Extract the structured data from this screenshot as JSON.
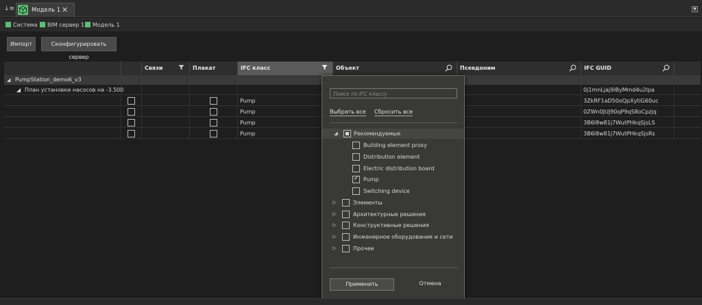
{
  "tab": {
    "title": "Модель 1",
    "close": "✕"
  },
  "breadcrumb": [
    "Система",
    "BIM сервер 1",
    "Модель 1"
  ],
  "toolbar": {
    "import_label": "Импорт",
    "configure_label": "Сконфигурировать сервер"
  },
  "columns": [
    {
      "key": "name",
      "label": ""
    },
    {
      "key": "check",
      "label": ""
    },
    {
      "key": "links",
      "label": "Связи"
    },
    {
      "key": "poster",
      "label": "Плакат"
    },
    {
      "key": "ifc_class",
      "label": "IFC класс"
    },
    {
      "key": "object",
      "label": "Объект"
    },
    {
      "key": "alias",
      "label": "Псевдоним"
    },
    {
      "key": "ifc_guid",
      "label": "IFC GUID"
    }
  ],
  "group": {
    "label": "PumpStation_demo6_v3"
  },
  "rows": [
    {
      "name": "План установки насосов на -3.500",
      "ifc_class": "",
      "ifc_guid": "0j1mnLjaj9iByMmd4u2lpa",
      "has_checks": false
    },
    {
      "name": "",
      "ifc_class": "Pump",
      "ifc_guid": "3ZkRF1aD50oQpXytiG60uc",
      "has_checks": true
    },
    {
      "name": "",
      "ifc_class": "Pump",
      "ifc_guid": "0ZWn0JUJ90qP9qS8oCpzjq",
      "has_checks": true
    },
    {
      "name": "",
      "ifc_class": "Pump",
      "ifc_guid": "3B6l8w81j7WutPHkqSjsLS",
      "has_checks": true
    },
    {
      "name": "",
      "ifc_class": "Pump",
      "ifc_guid": "3B6l8w81j7WutPHkqSjsRs",
      "has_checks": true
    }
  ],
  "filter_popup": {
    "search_placeholder": "Поиск по IFC классу",
    "select_all": "Выбрать все",
    "reset_all": "Сбросить все",
    "recommended": {
      "label": "Рекомендуемые",
      "items": [
        {
          "label": "Building element proxy",
          "checked": false
        },
        {
          "label": "Distribution element",
          "checked": false
        },
        {
          "label": "Electric distribution board",
          "checked": false
        },
        {
          "label": "Pump",
          "checked": true
        },
        {
          "label": "Switching device",
          "checked": false
        }
      ]
    },
    "groups": [
      "Элементы",
      "Архитектурные решения",
      "Конструктивные решения",
      "Инженерное оборудование и сети",
      "Прочее"
    ],
    "apply": "Применить",
    "cancel": "Отмена"
  },
  "colors": {
    "accent_green": "#5cbf74",
    "background": "#1e1e1e",
    "header": "#2e2e2e",
    "popup": "#393937"
  }
}
